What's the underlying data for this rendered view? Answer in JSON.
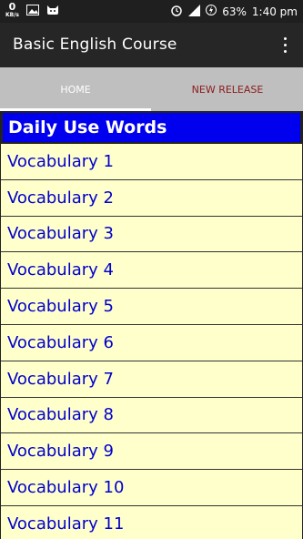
{
  "status": {
    "net_speed": "0",
    "net_unit": "KB/s",
    "battery": "63%",
    "time": "1:40 pm"
  },
  "app": {
    "title": "Basic English Course"
  },
  "tabs": [
    {
      "label": "HOME",
      "selected": true
    },
    {
      "label": "NEW RELEASE",
      "selected": false
    }
  ],
  "list": {
    "header": "Daily Use Words",
    "items": [
      "Vocabulary 1",
      "Vocabulary 2",
      "Vocabulary 3",
      "Vocabulary 4",
      "Vocabulary 5",
      "Vocabulary 6",
      "Vocabulary 7",
      "Vocabulary 8",
      "Vocabulary 9",
      "Vocabulary 10",
      "Vocabulary 11"
    ]
  },
  "colors": {
    "status_bar": "#1f1f1f",
    "toolbar": "#262626",
    "tabs_bg": "#bfbfbf",
    "header_bg": "#0000ee",
    "list_bg": "#ffffcc",
    "link_text": "#0000cc",
    "new_release_text": "#8b1a1a"
  }
}
